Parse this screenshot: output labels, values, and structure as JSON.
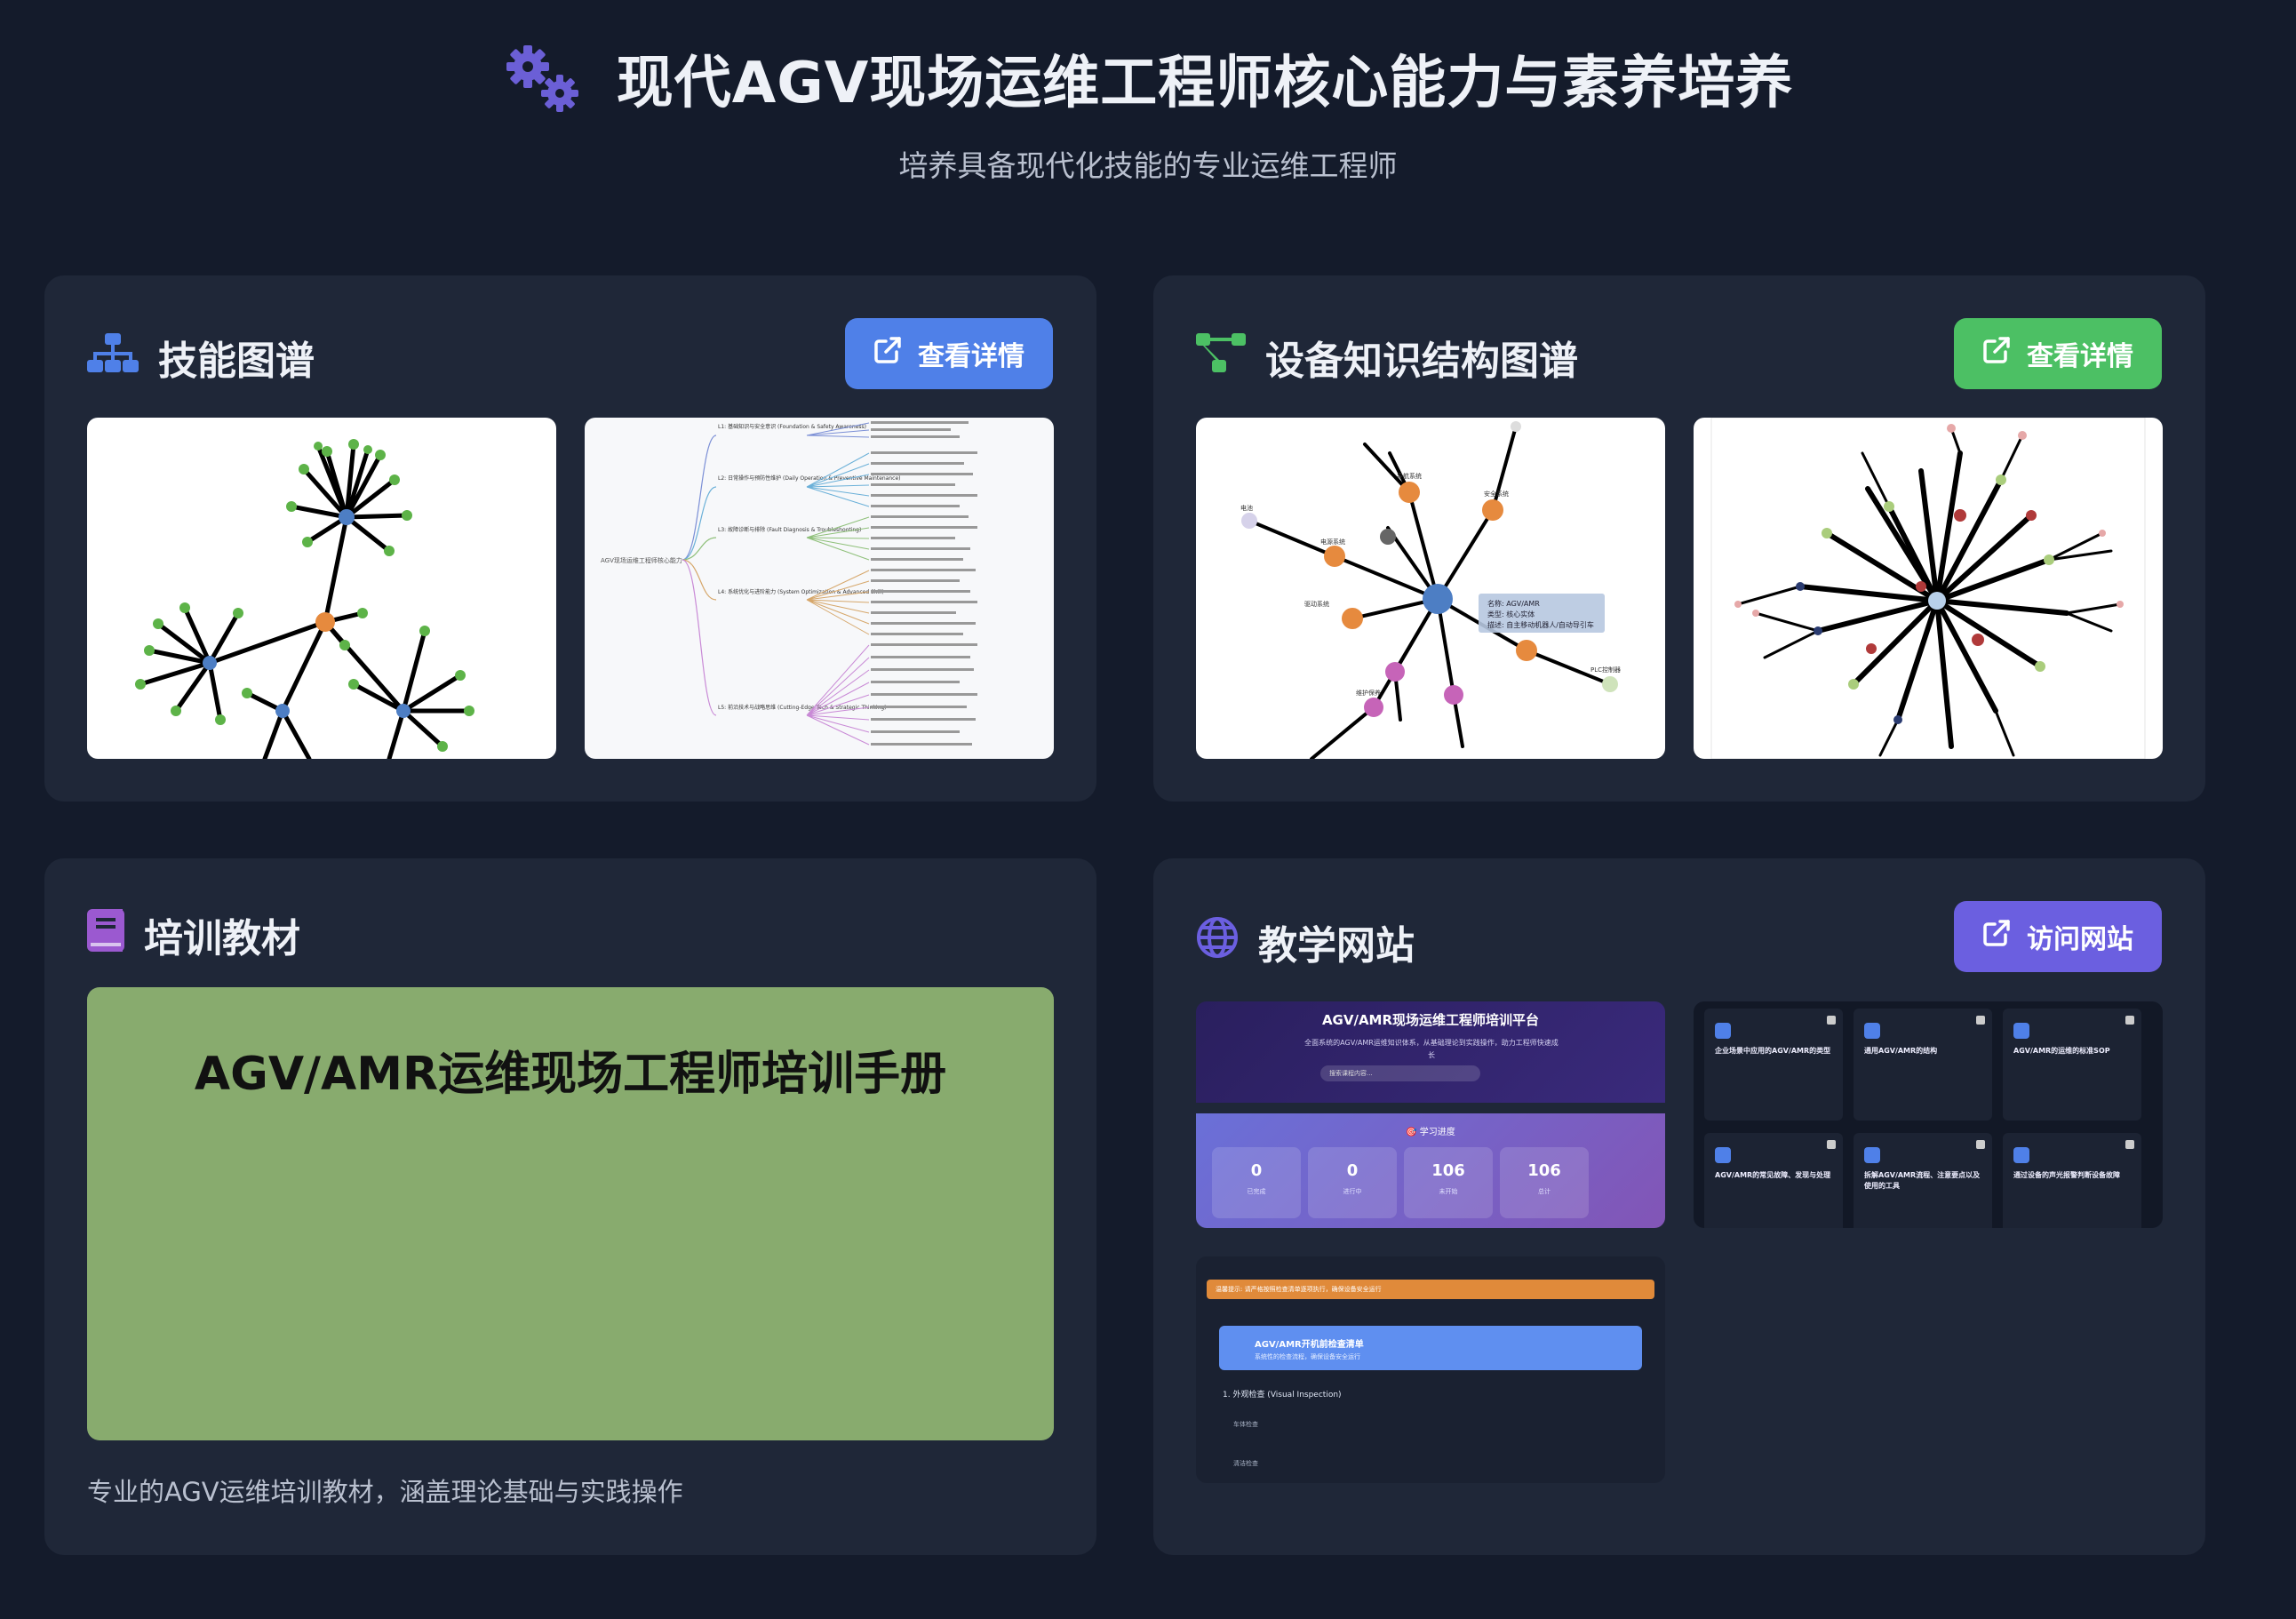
{
  "header": {
    "title": "现代AGV现场运维工程师核心能力与素养培养",
    "subtitle": "培养具备现代化技能的专业运维工程师"
  },
  "cards": {
    "skills": {
      "title": "技能图谱",
      "button": "查看详情",
      "icon": "sitemap-icon",
      "accent": "#4f80e8"
    },
    "equipment": {
      "title": "设备知识结构图谱",
      "button": "查看详情",
      "icon": "project-diagram-icon",
      "accent": "#4cc064"
    },
    "training": {
      "title": "培训教材",
      "icon": "book-icon",
      "manual_title": "AGV/AMR运维现场工程师培训手册",
      "description": "专业的AGV运维培训教材，涵盖理论基础与实践操作",
      "accent": "#9b59d0"
    },
    "website": {
      "title": "教学网站",
      "button": "访问网站",
      "icon": "globe-icon",
      "accent": "#6b5fe0"
    }
  },
  "thumbnails": {
    "skill_mindmap_root": "AGV现场运维工程师核心能力",
    "skill_levels": [
      "L1: 基础知识与安全意识 (Foundation & Safety Awareness)",
      "L2: 日常操作与预防性维护 (Daily Operation & Preventive Maintenance)",
      "L3: 故障诊断与排除 (Fault Diagnosis & Troubleshooting)",
      "L4: 系统优化与进阶能力 (System Optimization & Advanced Skill)",
      "L5: 前沿技术与战略思维 (Cutting-Edge Tech & Strategic Thinking)"
    ],
    "equip_tooltip": [
      "名称: AGV/AMR",
      "类型: 核心实体",
      "描述: 自主移动机器人/自动导引车"
    ],
    "equip_labels": [
      "电池",
      "电源系统",
      "导航系统",
      "安全系统",
      "驱动系统",
      "PLC控制器",
      "维护保养"
    ],
    "website_platform_title": "AGV/AMR现场运维工程师培训平台",
    "website_platform_sub": "全面系统的AGV/AMR运维知识体系，从基础理论到实践操作，助力工程师快速成长",
    "website_search_placeholder": "搜索课程内容...",
    "website_progress_title": "🎯 学习进度",
    "website_stats": [
      {
        "value": "0",
        "label": "已完成"
      },
      {
        "value": "0",
        "label": "进行中"
      },
      {
        "value": "106",
        "label": "未开始"
      },
      {
        "value": "106",
        "label": "总计"
      }
    ],
    "website_modules": [
      "企业场景中应用的AGV/AMR的类型",
      "通用AGV/AMR的结构",
      "AGV/AMR的运维的标准SOP",
      "AGV/AMR的常见故障、发现与处理",
      "拆解AGV/AMR流程、注意要点以及使用的工具",
      "通过设备的声光报警判断设备故障"
    ],
    "checklist_warning": "温馨提示: 请严格按照检查清单逐项执行，确保设备安全运行",
    "checklist_title": "AGV/AMR开机前检查清单",
    "checklist_sub": "系统性的检查流程，确保设备安全运行",
    "checklist_section": "1. 外观检查 (Visual Inspection)",
    "checklist_items": [
      "车体检查",
      "清洁检查"
    ]
  }
}
